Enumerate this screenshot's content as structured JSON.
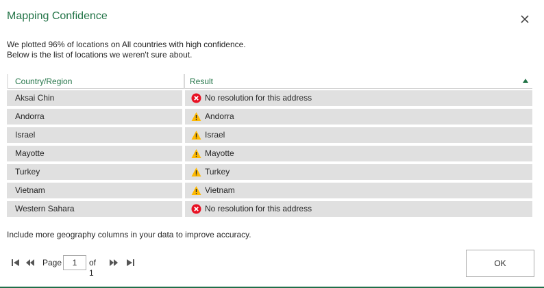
{
  "dialog": {
    "title": "Mapping Confidence",
    "description_line1": "We plotted 96% of locations on All countries with high confidence.",
    "description_line2": "Below is the list of locations we weren't sure about.",
    "hint": "Include more geography columns in your data to improve accuracy."
  },
  "table": {
    "headers": [
      "Country/Region",
      "Result"
    ],
    "sort": "ascending",
    "rows": [
      {
        "country": "Aksai Chin",
        "result": "No resolution for this address",
        "status": "error"
      },
      {
        "country": "Andorra",
        "result": "Andorra",
        "status": "warning"
      },
      {
        "country": "Israel",
        "result": "Israel",
        "status": "warning"
      },
      {
        "country": "Mayotte",
        "result": "Mayotte",
        "status": "warning"
      },
      {
        "country": "Turkey",
        "result": "Turkey",
        "status": "warning"
      },
      {
        "country": "Vietnam",
        "result": "Vietnam",
        "status": "warning"
      },
      {
        "country": "Western Sahara",
        "result": "No resolution for this address",
        "status": "error"
      }
    ]
  },
  "pager": {
    "page_label": "Page",
    "current_page": "1",
    "of_label": "of 1"
  },
  "buttons": {
    "ok": "OK"
  },
  "icons": {
    "close": "close-icon",
    "error": "error-circle-icon",
    "warning": "warning-triangle-icon",
    "sort": "sort-up-icon",
    "first": "first-page-icon",
    "prev": "previous-page-icon",
    "next": "next-page-icon",
    "last": "last-page-icon"
  },
  "colors": {
    "accent": "#217346",
    "error": "#e81123",
    "warning": "#ffb900",
    "row_bg": "#e0e0e0"
  }
}
